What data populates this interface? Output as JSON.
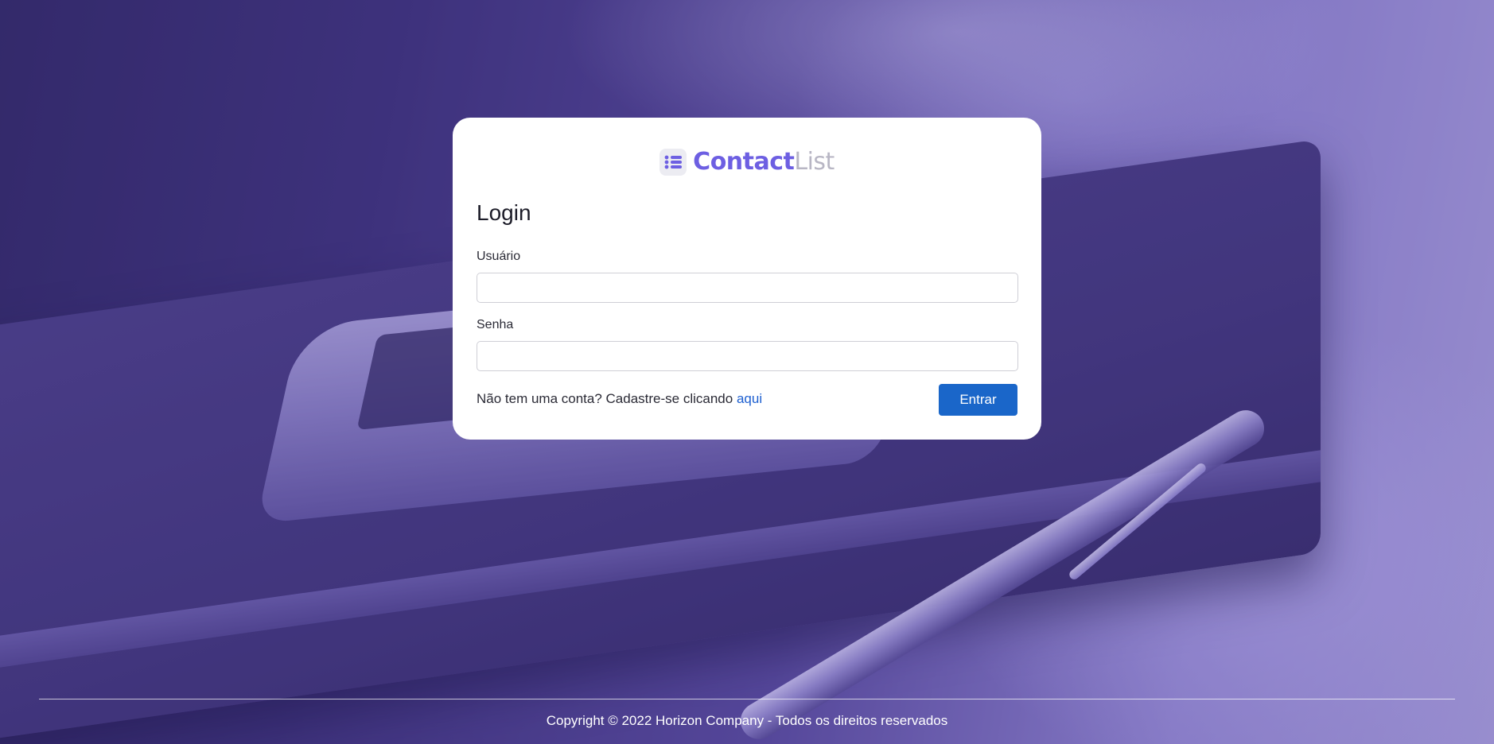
{
  "brand": {
    "name_part1": "Contact",
    "name_part2": "List",
    "icon": "list-icon"
  },
  "login": {
    "title": "Login",
    "username_label": "Usuário",
    "username_value": "",
    "password_label": "Senha",
    "password_value": "",
    "signup_text": "Não tem uma conta? Cadastre-se clicando ",
    "signup_link": "aqui",
    "submit_label": "Entrar"
  },
  "footer": {
    "copyright": "Copyright © 2022 Horizon Company - Todos os direitos reservados"
  },
  "colors": {
    "brand_primary": "#6d5fe2",
    "brand_secondary": "#b8b6c4",
    "button": "#1a66c9",
    "link": "#1d5fd0"
  }
}
